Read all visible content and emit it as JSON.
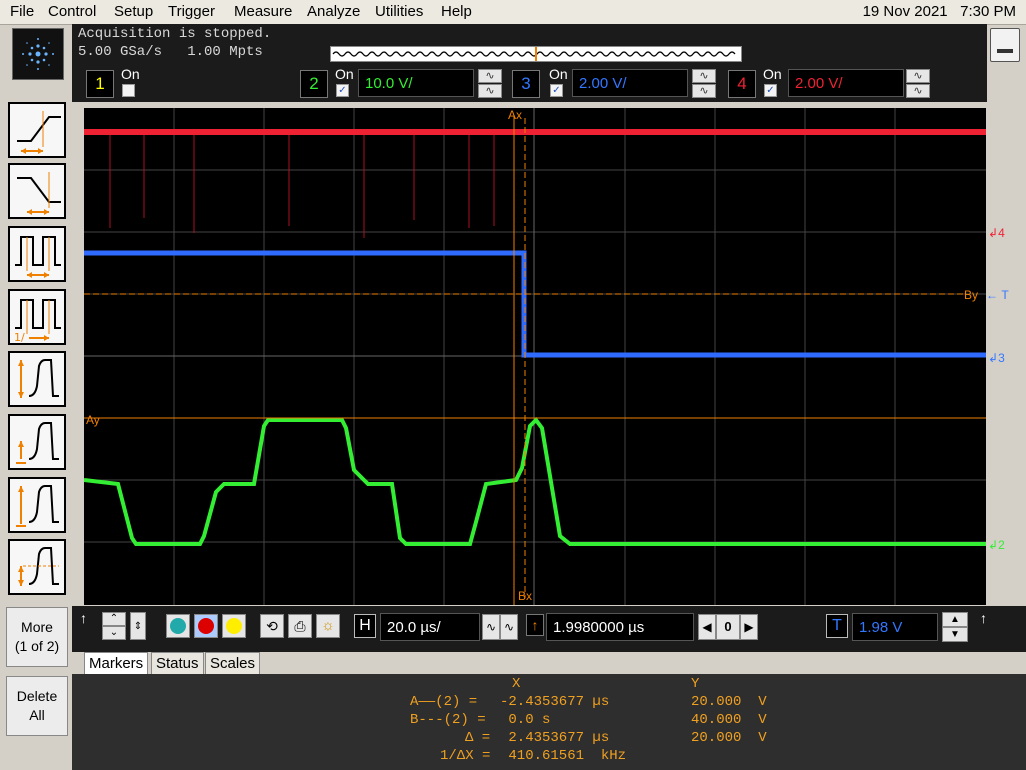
{
  "menu": {
    "items": [
      "File",
      "Control",
      "Setup",
      "Trigger",
      "Measure",
      "Analyze",
      "Utilities",
      "Help"
    ],
    "datetime": "19 Nov 2021   7:30 PM"
  },
  "acquisition": {
    "status": "Acquisition is stopped.",
    "rate": "5.00 GSa/s   1.00 Mpts"
  },
  "channels": [
    {
      "num": "1",
      "on_label": "On",
      "checked": false,
      "color": "#ffff00"
    },
    {
      "num": "2",
      "on_label": "On",
      "checked": true,
      "scale": "10.0 V/",
      "color": "#33ee33"
    },
    {
      "num": "3",
      "on_label": "On",
      "checked": true,
      "scale": "2.00 V/",
      "color": "#3377ff"
    },
    {
      "num": "4",
      "on_label": "On",
      "checked": true,
      "scale": "2.00 V/",
      "color": "#ee2233"
    }
  ],
  "left_buttons": {
    "more": "More\n(1 of 2)",
    "delete_all": "Delete\nAll"
  },
  "screen": {
    "marker_ax": "Ax",
    "marker_bx": "Bx",
    "marker_ay": "Ay",
    "marker_by": "By",
    "ch4_marker": "4",
    "ch3_marker": "3",
    "ch2_marker": "2",
    "trigger_marker": "T"
  },
  "timebase": {
    "label": "H",
    "scale": "20.0 µs/",
    "delay": "1.9980000 µs",
    "ref": "0"
  },
  "trigger": {
    "label": "T",
    "level": "1.98 V"
  },
  "tabs": [
    "Markers",
    "Status",
    "Scales"
  ],
  "markers": {
    "header_x": "X",
    "header_y": "Y",
    "rows": [
      {
        "label": "A——(2) =",
        "x": "-2.4353677 µs",
        "y": "20.000  V"
      },
      {
        "label": "B---(2) =",
        "x": " 0.0 s",
        "y": "40.000  V"
      },
      {
        "label": "Δ =",
        "x": " 2.4353677 µs",
        "y": "20.000  V"
      },
      {
        "label": "1/ΔX =",
        "x": " 410.61561  kHz",
        "y": ""
      }
    ]
  }
}
